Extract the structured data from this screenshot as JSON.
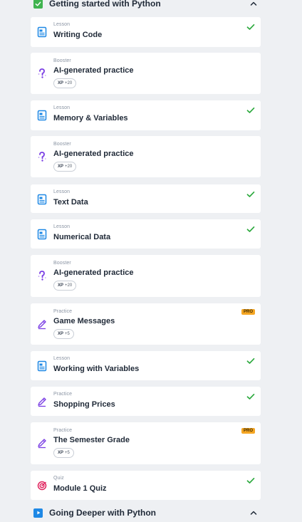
{
  "sections": [
    {
      "title": "Getting started with Python"
    },
    {
      "title": "Going Deeper with Python"
    }
  ],
  "items": [
    {
      "kind": "Lesson",
      "title": "Writing Code",
      "status": "complete"
    },
    {
      "kind": "Booster",
      "title": "AI-generated practice",
      "xp": "+20"
    },
    {
      "kind": "Lesson",
      "title": "Memory & Variables",
      "status": "complete"
    },
    {
      "kind": "Booster",
      "title": "AI-generated practice",
      "xp": "+20"
    },
    {
      "kind": "Lesson",
      "title": "Text Data",
      "status": "complete"
    },
    {
      "kind": "Lesson",
      "title": "Numerical Data",
      "status": "complete"
    },
    {
      "kind": "Booster",
      "title": "AI-generated practice",
      "xp": "+20"
    },
    {
      "kind": "Practice",
      "title": "Game Messages",
      "xp": "+5",
      "badge": "PRO"
    },
    {
      "kind": "Lesson",
      "title": "Working with Variables",
      "status": "complete"
    },
    {
      "kind": "Practice",
      "title": "Shopping Prices",
      "status": "complete"
    },
    {
      "kind": "Practice",
      "title": "The Semester Grade",
      "xp": "+5",
      "badge": "PRO"
    },
    {
      "kind": "Quiz",
      "title": "Module 1 Quiz",
      "status": "complete"
    }
  ],
  "xp_label": "XP",
  "icons": {
    "Lesson": "lesson-document-icon",
    "Booster": "booster-question-icon",
    "Practice": "practice-pencil-icon",
    "Quiz": "quiz-target-icon",
    "complete": "checkmark-icon",
    "section_complete": "checkbox-checked-icon",
    "section_play": "play-icon",
    "collapse": "chevron-up-icon"
  },
  "colors": {
    "background": "#eef0f3",
    "card": "#ffffff",
    "check": "#2eaa3f",
    "lesson_icon": "#1e88e5",
    "booster_icon": "#7b3fe4",
    "practice_icon": "#7b3fe4",
    "quiz_icon": "#e0245e",
    "pro_badge": "#f5a623",
    "section_complete": "#3fb34f",
    "section_play": "#1e88e5"
  }
}
